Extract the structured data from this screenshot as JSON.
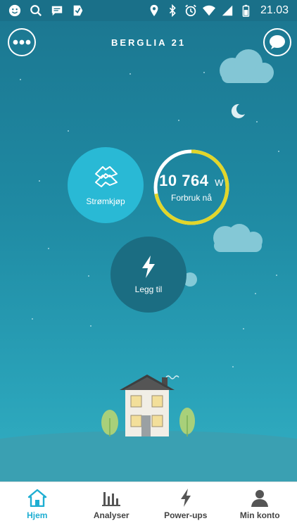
{
  "status_bar": {
    "time": "21.03"
  },
  "header": {
    "title": "BERGLIA 21"
  },
  "actions": {
    "stromkjop_label": "Strømkjøp",
    "usage_value": "10 764",
    "usage_unit": "W",
    "usage_label": "Forbruk nå",
    "usage_ring_fraction": 0.72,
    "add_label": "Legg til"
  },
  "bottom_nav": {
    "items": [
      {
        "label": "Hjem",
        "icon": "home-icon",
        "active": true
      },
      {
        "label": "Analyser",
        "icon": "bar-chart-icon",
        "active": false
      },
      {
        "label": "Power-ups",
        "icon": "lightning-icon",
        "active": false
      },
      {
        "label": "Min konto",
        "icon": "person-icon",
        "active": false
      }
    ]
  },
  "colors": {
    "accent": "#1eaed2",
    "gauge": "#e1d62a",
    "sky_top": "#1b7690",
    "sky_bottom": "#38b5c8"
  }
}
